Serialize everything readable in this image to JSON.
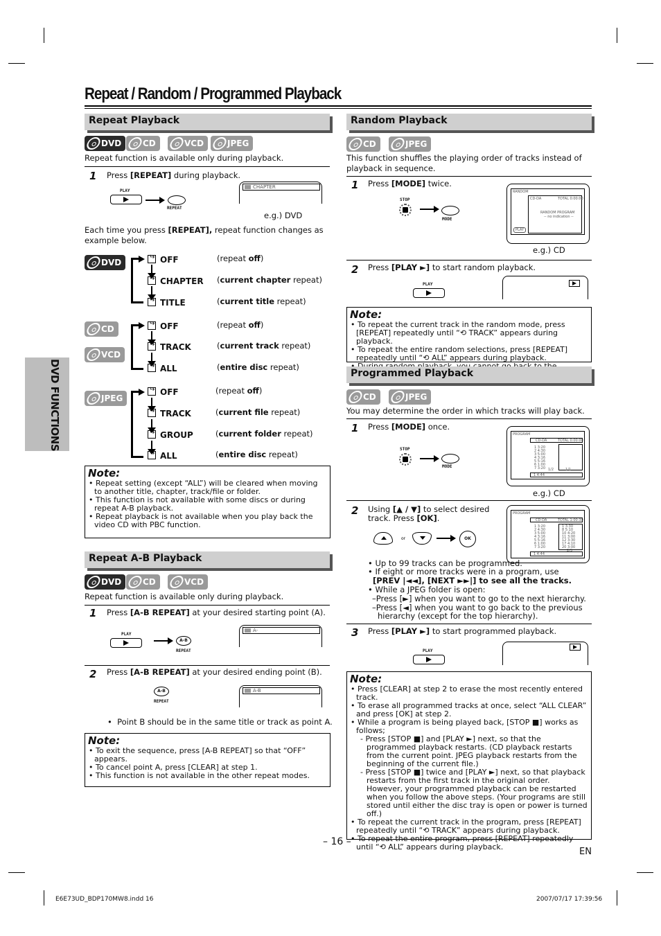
{
  "page_title": "Repeat / Random / Programmed Playback",
  "side_tab": "DVD FUNCTIONS",
  "page_number": "– 16 –",
  "language": "EN",
  "footer": {
    "file": "E6E73UD_BDP170MW8.indd   16",
    "timestamp": "2007/07/17   17:39:56"
  },
  "repeat": {
    "heading": "Repeat Playback",
    "badges": [
      "DVD",
      "CD",
      "VCD",
      "JPEG"
    ],
    "intro": "Repeat function is available only during playback.",
    "step1": {
      "num": "1",
      "pre": "Press ",
      "key": "[REPEAT]",
      "post": " during playback."
    },
    "play_label": "PLAY",
    "repeat_label": "REPEAT",
    "osd_text": "CHAPTER",
    "caption": "e.g.) DVD",
    "each_time_pre": "Each time you press ",
    "each_time_key": "[REPEAT],",
    "each_time_post": " repeat function changes as",
    "each_time_line2": "example below.",
    "groups": [
      {
        "badges": [
          "DVD"
        ],
        "items": [
          {
            "label": "OFF",
            "desc_pre": "(repeat ",
            "desc_bold": "off",
            "desc_post": ")"
          },
          {
            "label": "CHAPTER",
            "desc_pre": "(",
            "desc_bold": "current chapter",
            "desc_post": " repeat)"
          },
          {
            "label": "TITLE",
            "desc_pre": "(",
            "desc_bold": "current title",
            "desc_post": " repeat)"
          }
        ]
      },
      {
        "badges": [
          "CD",
          "VCD"
        ],
        "items": [
          {
            "label": "OFF",
            "desc_pre": "(repeat ",
            "desc_bold": "off",
            "desc_post": ")"
          },
          {
            "label": "TRACK",
            "desc_pre": "(",
            "desc_bold": "current track",
            "desc_post": " repeat)"
          },
          {
            "label": "ALL",
            "desc_pre": "(",
            "desc_bold": "entire disc",
            "desc_post": " repeat)"
          }
        ]
      },
      {
        "badges": [
          "JPEG"
        ],
        "items": [
          {
            "label": "OFF",
            "desc_pre": "(repeat ",
            "desc_bold": "off",
            "desc_post": ")"
          },
          {
            "label": "TRACK",
            "desc_pre": "(",
            "desc_bold": "current file",
            "desc_post": " repeat)"
          },
          {
            "label": "GROUP",
            "desc_pre": "(",
            "desc_bold": "current folder",
            "desc_post": " repeat)"
          },
          {
            "label": "ALL",
            "desc_pre": "(",
            "desc_bold": "entire disc",
            "desc_post": " repeat)"
          }
        ]
      }
    ],
    "note": {
      "title": "Note:",
      "items": [
        "Repeat setting (except “ALL”) will be cleared when moving to another title, chapter, track/file or folder.",
        "This function is not available with some discs or during repeat A-B playback.",
        "Repeat playback is not available when you play back the video CD with PBC function."
      ]
    }
  },
  "ab": {
    "heading": "Repeat A-B Playback",
    "badges": [
      "DVD",
      "CD",
      "VCD"
    ],
    "intro": "Repeat function is available only during playback.",
    "step1": {
      "num": "1",
      "pre": "Press ",
      "key": "[A-B REPEAT]",
      "post": " at your desired starting point (A)."
    },
    "step2": {
      "num": "2",
      "pre": "Press ",
      "key": "[A-B REPEAT]",
      "post": " at your desired ending point (B)."
    },
    "play_label": "PLAY",
    "ab_label": "A-B",
    "repeat_label": "REPEAT",
    "osd1": "A-",
    "osd2": "A-B",
    "bullet": "Point B should be in the same title or track as point A.",
    "note": {
      "title": "Note:",
      "items": [
        "To exit the sequence, press [A-B REPEAT] so that “OFF” appears.",
        "To cancel point A, press [CLEAR] at step 1.",
        "This function is not available in the other repeat modes."
      ]
    }
  },
  "random": {
    "heading": "Random Playback",
    "badges": [
      "CD",
      "JPEG"
    ],
    "intro1": "This function shuffles the playing order of tracks instead of",
    "intro2": "playback in sequence.",
    "step1": {
      "num": "1",
      "pre": "Press ",
      "key": "[MODE]",
      "post": " twice."
    },
    "step2": {
      "num": "2",
      "pre": "Press ",
      "key": "[PLAY ►]",
      "post": " to start random playback."
    },
    "stop_label": "STOP",
    "mode_label": "MODE",
    "play_label": "PLAY",
    "screen": {
      "title": "RANDOM",
      "disc": "CD-DA",
      "total": "TOTAL 0:00:00",
      "line1": "RANDOM PROGRAM",
      "line2": "-- no indication --",
      "btn": "PLAY"
    },
    "caption": "e.g.) CD",
    "note": {
      "title": "Note:",
      "items": [
        "To repeat the current track in the random mode, press [REPEAT] repeatedly until “⟲ TRACK” appears during playback.",
        "To repeat the entire random selections, press [REPEAT] repeatedly until “⟲ ALL” appears during playback.",
        "During random playback, you cannot go back to the previous track."
      ]
    }
  },
  "program": {
    "heading": "Programmed Playback",
    "badges": [
      "CD",
      "JPEG"
    ],
    "intro": "You may determine the order in which tracks will play back.",
    "step1": {
      "num": "1",
      "pre": "Press ",
      "key": "[MODE]",
      "post": " once."
    },
    "step2": {
      "num": "2",
      "line1_pre": "Using ",
      "line1_key": "[▲ / ▼]",
      "line1_post": " to select desired",
      "line2_pre": "track. Press ",
      "line2_key": "[OK]",
      "line2_post": "."
    },
    "step3": {
      "num": "3",
      "pre": "Press ",
      "key": "[PLAY ►]",
      "post": " to start programmed playback."
    },
    "stop_label": "STOP",
    "mode_label": "MODE",
    "play_label": "PLAY",
    "or_label": "or",
    "ok_label": "OK",
    "screen": {
      "title": "PROGRAM",
      "disc": "CD-DA",
      "total": "TOTAL 0:00:00",
      "tracks": [
        "1  3:20",
        "2  4:30",
        "3  5:00",
        "4  3:16",
        "5  5:16",
        "6  1:00",
        "7  3:20"
      ],
      "page": "1/2",
      "pages2": "1/1",
      "footer": "1  4:44"
    },
    "screen2": {
      "total": "TOTAL 1:00:30",
      "prog": [
        "1  3:30",
        "8  5:10",
        "10  4:20",
        "11  3:00",
        "12  3:30",
        "17  4:10",
        "20  3:00"
      ],
      "nav": "2/3"
    },
    "caption": "e.g.) CD",
    "bullets": [
      "Up to 99 tracks can be programmed.",
      "If eight or more tracks were in a program, use",
      "[PREV |◄◄], [NEXT ►►|] to see all the tracks.",
      "While a JPEG folder is open:",
      "–Press [►] when you want to go to the next hierarchy.",
      "–Press [◄] when you want to go back to the previous",
      "hierarchy (except for the top hierarchy)."
    ],
    "note": {
      "title": "Note:",
      "items": [
        "Press [CLEAR] at step 2 to erase the most recently entered track.",
        "To erase all programmed tracks at once, select “ALL CLEAR” and press [OK] at step 2.",
        "While a program is being played back, [STOP ■] works as follows;"
      ],
      "subitems": [
        "- Press [STOP ■] and [PLAY ►] next, so that the programmed playback restarts. (CD playback restarts from the current point. JPEG playback restarts from the beginning of the current file.)",
        "- Press [STOP ■] twice and [PLAY ►] next, so that playback restarts from the first track in the original order. However, your programmed playback can be restarted when you follow the above steps. (Your programs are still stored until either the disc tray is open or power is turned off.)"
      ],
      "items2": [
        "To repeat the current track in the program, press [REPEAT] repeatedly until “⟲ TRACK” appears during playback.",
        "To repeat the entire program, press [REPEAT] repeatedly until “⟲ ALL” appears during playback."
      ]
    }
  }
}
